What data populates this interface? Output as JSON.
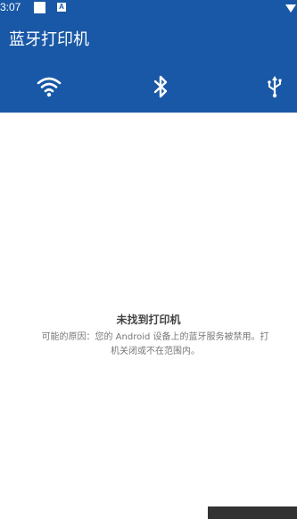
{
  "status_bar": {
    "time": "3:07",
    "a_badge": "A"
  },
  "header": {
    "title": "蓝牙打印机"
  },
  "tabs": [
    {
      "icon": "wifi-icon"
    },
    {
      "icon": "bluetooth-icon"
    },
    {
      "icon": "usb-icon"
    }
  ],
  "empty_state": {
    "title": "未找到打印机",
    "line1": "可能的原因：您的 Android 设备上的蓝牙服务被禁用。打",
    "line2": "机关闭或不在范围内。"
  },
  "colors": {
    "app_bar": "#1958a6",
    "text_primary": "#444444",
    "text_secondary": "#777777"
  }
}
